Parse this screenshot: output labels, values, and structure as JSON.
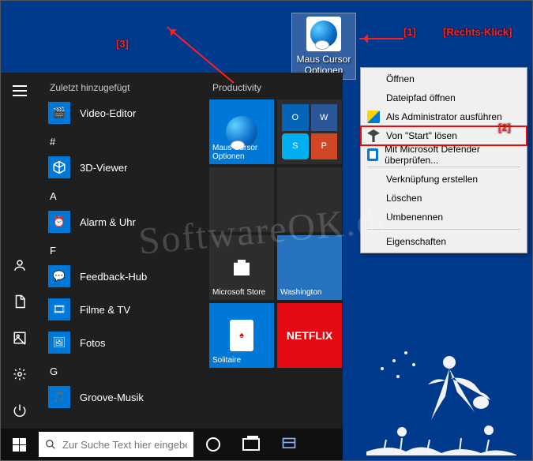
{
  "desktop_icon": {
    "label_line1": "Maus Cursor",
    "label_line2": "Optionen"
  },
  "context_menu": {
    "open": "Öffnen",
    "open_path": "Dateipfad öffnen",
    "run_admin": "Als Administrator ausführen",
    "unpin": "Von \"Start\" lösen",
    "defender": "Mit Microsoft Defender überprüfen...",
    "create_shortcut": "Verknüpfung erstellen",
    "delete": "Löschen",
    "rename": "Umbenennen",
    "properties": "Eigenschaften"
  },
  "start": {
    "recent_header": "Zuletzt hinzugefügt",
    "apps": {
      "video_editor": "Video-Editor",
      "number": "#",
      "viewer3d": "3D-Viewer",
      "letter_a": "A",
      "alarm": "Alarm & Uhr",
      "letter_f": "F",
      "feedback": "Feedback-Hub",
      "filme": "Filme & TV",
      "fotos": "Fotos",
      "letter_g": "G",
      "groove": "Groove-Musik"
    },
    "tile_group": "Productivity",
    "tiles": {
      "maus_line1": "Maus Cursor",
      "maus_line2": "Optionen",
      "store": "Microsoft Store",
      "washington": "Washington",
      "solitaire": "Solitaire",
      "netflix": "NETFLIX"
    }
  },
  "taskbar": {
    "search_placeholder": "Zur Suche Text hier eingeben"
  },
  "annotations": {
    "a1": "[1]",
    "a1_label": "[Rechts-Klick]",
    "a2": "[2]",
    "a3": "[3]"
  },
  "watermark": "SoftwareOK.de"
}
